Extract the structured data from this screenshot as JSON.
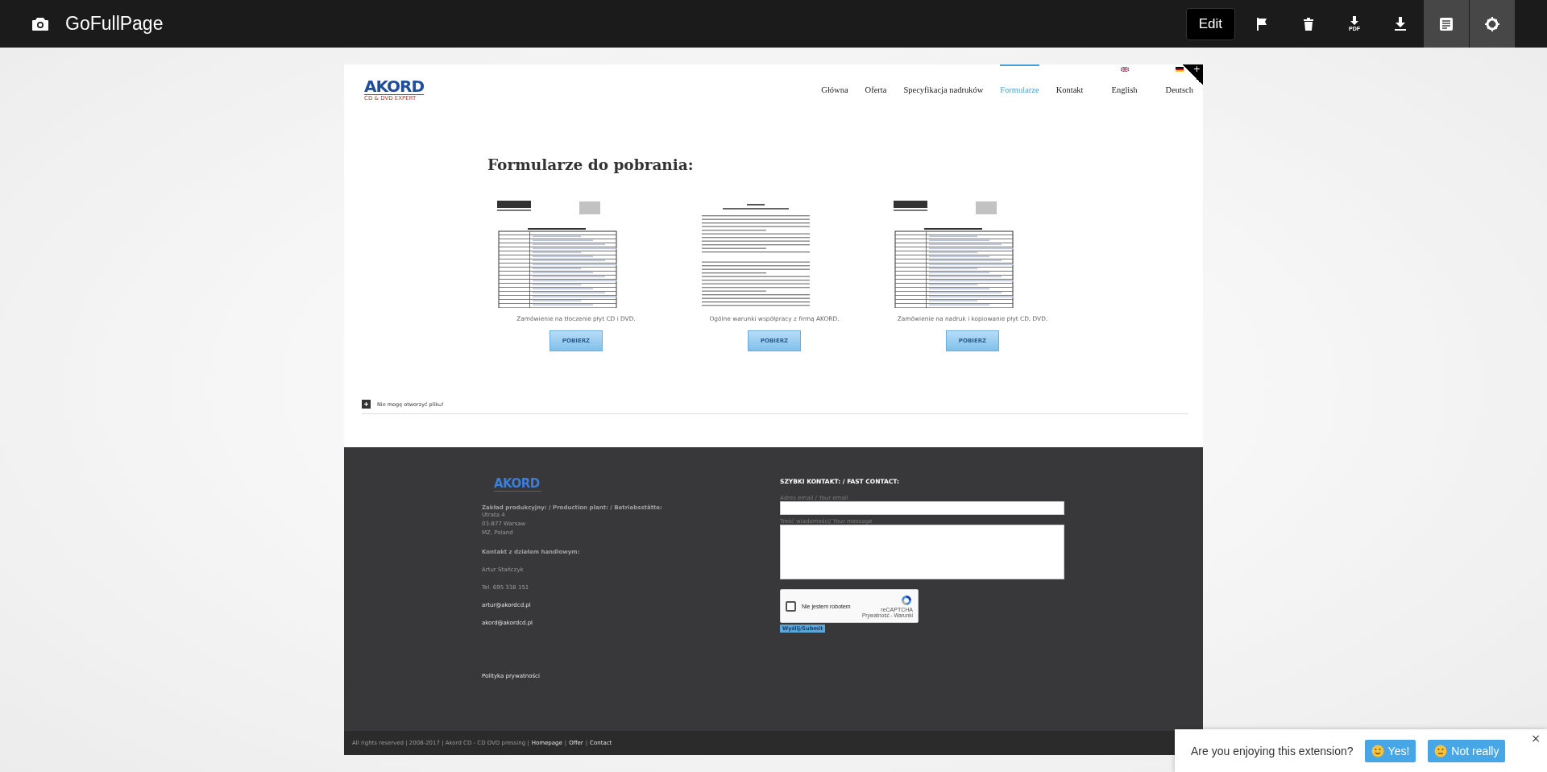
{
  "toolbar": {
    "title": "GoFullPage",
    "edit_label": "Edit",
    "actions": [
      {
        "kind": "flag",
        "active": false
      },
      {
        "kind": "trash",
        "active": false
      },
      {
        "kind": "pdf",
        "label": "PDF",
        "active": false
      },
      {
        "kind": "download",
        "active": false
      },
      {
        "kind": "document",
        "active": true
      },
      {
        "kind": "settings",
        "active": true
      }
    ]
  },
  "site": {
    "logo": {
      "name": "AKORD",
      "tagline": "CD & DVD EXPERT"
    },
    "corner_toggle": "+",
    "nav": [
      {
        "label": "Główna",
        "selected": false
      },
      {
        "label": "Oferta",
        "selected": false
      },
      {
        "label": "Specyfikacja nadruków",
        "selected": false
      },
      {
        "label": "Formularze",
        "selected": true
      },
      {
        "label": "Kontakt",
        "selected": false
      },
      {
        "label": "English",
        "selected": false,
        "kind": "gb"
      },
      {
        "label": "Deutsch",
        "selected": false,
        "kind": "de"
      }
    ],
    "heading": "Formularze do pobrania:",
    "forms": [
      {
        "kind": "order",
        "caption": "Zamówienie na tłoczenie płyt CD i DVD.",
        "button": "POBIERZ"
      },
      {
        "kind": "terms",
        "caption": "Ogólne warunki współpracy z firmą AKORD.",
        "button": "POBIERZ"
      },
      {
        "kind": "order",
        "caption": "Zamówienie na nadruk i kopiowanie płyt CD, DVD.",
        "button": "POBIERZ"
      }
    ],
    "accordion": {
      "label": "Nie mogę otworzyć pliku!",
      "expanded": false
    },
    "footer": {
      "logo": "AKORD",
      "address_title": "Zakład produkcyjny: / Production plant: / Betriebsstätte:",
      "address_lines": [
        "Utrata 4",
        "03-877 Warsaw",
        "MZ, Poland"
      ],
      "contact_title": "Kontakt z działem handlowym:",
      "contact_lines": [
        {
          "kind": "plain",
          "text": "Artur Stańczyk"
        },
        {
          "kind": "plain",
          "text": "Tel. 695 338 151"
        },
        {
          "kind": "link",
          "text": "artur@akordcd.pl"
        },
        {
          "kind": "link",
          "text": "akord@akordcd.pl"
        }
      ],
      "privacy": "Polityka prywatności",
      "form": {
        "title": "SZYBKI KONTAKT: / FAST CONTACT:",
        "email_label": "Adres email / Your email",
        "message_label": "Treść wiadomości/ Your message",
        "captcha": {
          "label": "Nie jestem robotem",
          "checked": false,
          "brand": "reCAPTCHA",
          "terms": "Prywatność - Warunki"
        },
        "submit": "Wyślij/Submit"
      }
    },
    "bottom_bar": {
      "copyright": "All rights reserved | 2008-2017 | Akord CD - CD DVD pressing |",
      "separator": "|",
      "links": [
        "Homepage",
        "Offer",
        "Contact"
      ]
    }
  },
  "popup": {
    "question": "Are you enjoying this extension?",
    "close": "×",
    "buttons": [
      {
        "kind": "happy",
        "label": "Yes!"
      },
      {
        "kind": "unsure",
        "label": "Not really"
      }
    ]
  }
}
